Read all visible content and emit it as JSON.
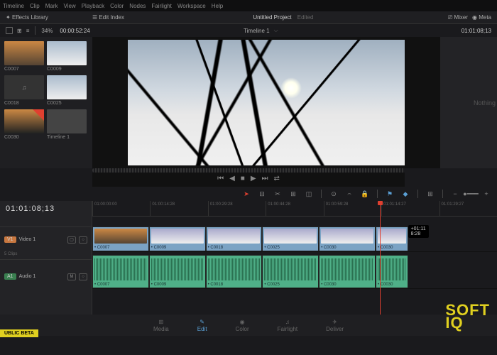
{
  "menu": {
    "items": [
      "Timeline",
      "Clip",
      "Mark",
      "View",
      "Playback",
      "Color",
      "Nodes",
      "Fairlight",
      "Workspace",
      "Help"
    ]
  },
  "topbar": {
    "effects": "Effects Library",
    "editindex": "Edit Index",
    "zoom": "34%",
    "tc": "00:00:52:24",
    "mixer": "Mixer",
    "meta": "Meta"
  },
  "project": {
    "title": "Untitled Project",
    "status": "Edited",
    "timeline": "Timeline 1",
    "viewer_tc": "01:01:08;13"
  },
  "thumbs": [
    {
      "name": "C0007"
    },
    {
      "name": "C0009"
    },
    {
      "name": "C0018"
    },
    {
      "name": "C0025"
    },
    {
      "name": "C0030"
    },
    {
      "name": "Timeline 1"
    }
  ],
  "inspector": {
    "empty": "Nothing"
  },
  "timeline": {
    "tc": "01:01:08;13",
    "ruler": [
      "01:00:00:00",
      "01:00:14:28",
      "01:00:29:28",
      "01:00:44:28",
      "01:00:59:28",
      "01:01:14:27",
      "01:01:29:27"
    ],
    "v1": {
      "badge": "V1",
      "label": "Video 1",
      "clips_info": "5 Clips"
    },
    "a1": {
      "badge": "A1",
      "label": "Audio 1"
    },
    "vclips": [
      {
        "w": "14%",
        "name": "• C0007"
      },
      {
        "w": "14%",
        "name": "• C0009"
      },
      {
        "w": "14%",
        "name": "• C0018"
      },
      {
        "w": "14%",
        "name": "• C0025"
      },
      {
        "w": "14%",
        "name": "• C0030"
      },
      {
        "w": "8%",
        "name": "• C0030"
      }
    ],
    "aclips": [
      {
        "w": "14%",
        "name": "• C0007"
      },
      {
        "w": "14%",
        "name": "• C0009"
      },
      {
        "w": "14%",
        "name": "• C0018"
      },
      {
        "w": "14%",
        "name": "• C0025"
      },
      {
        "w": "14%",
        "name": "• C0030"
      },
      {
        "w": "8%",
        "name": "• C0030"
      }
    ],
    "tip": {
      "line1": "+01:11",
      "line2": "8:28"
    }
  },
  "pages": {
    "media": "Media",
    "edit": "Edit",
    "color": "Color",
    "fairlight": "Fairlight",
    "deliver": "Deliver"
  },
  "beta": "UBLIC BETA",
  "watermark": {
    "l1": "SOFT",
    "l2": "IQ"
  }
}
